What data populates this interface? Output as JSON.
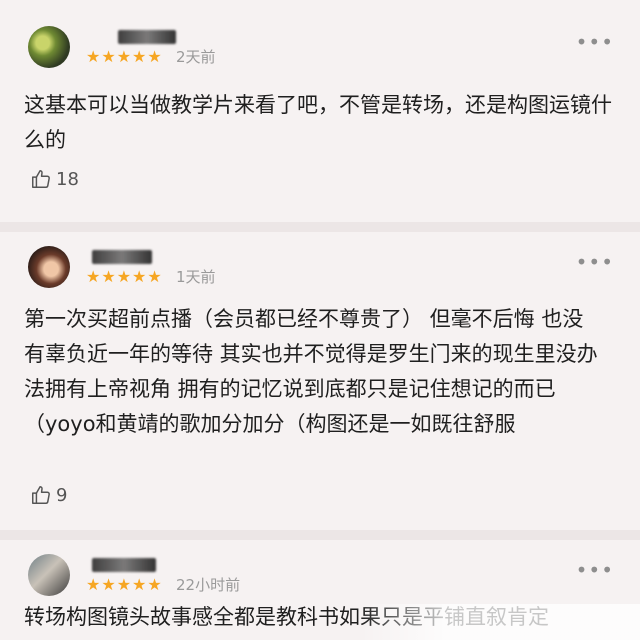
{
  "reviews": [
    {
      "stars": "★★★★★",
      "time": "2天前",
      "more": "•••",
      "content": "这基本可以当做教学片来看了吧，不管是转场，还是构图运镜什么的",
      "likes": "18"
    },
    {
      "stars": "★★★★★",
      "time": "1天前",
      "more": "•••",
      "content": "第一次买超前点播（会员都已经不尊贵了） 但毫不后悔 也没有辜负近一年的等待 其实也并不觉得是罗生门来的现生里没办法拥有上帝视角 拥有的记忆说到底都只是记住想记的而已（yoyo和黄靖的歌加分加分（构图还是一如既往舒服",
      "likes": "9"
    },
    {
      "stars": "★★★★★",
      "time": "22小时前",
      "more": "•••",
      "content": "转场构图镜头故事感全都是教科书如果只是平铺直叙肯定"
    }
  ],
  "colors": {
    "star": "#f6a623",
    "background": "#f6f2f2",
    "divider": "#ece6e6"
  },
  "icons": {
    "like": "thumbs-up-icon",
    "more": "more-dots-icon"
  }
}
